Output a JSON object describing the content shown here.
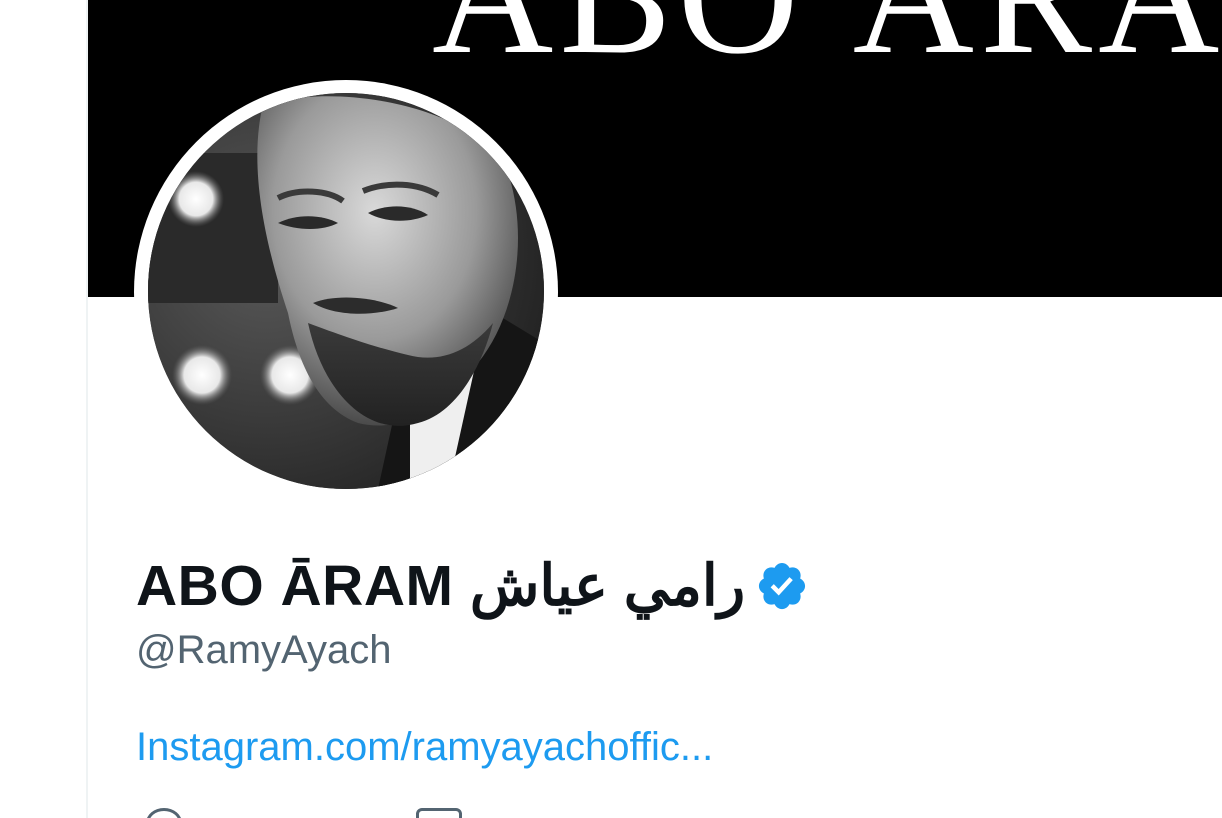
{
  "header": {
    "banner_text": "ABO ĀRA"
  },
  "profile": {
    "display_name": "ABO ĀRAM رامي عياش",
    "handle": "@RamyAyach",
    "bio_link": "Instagram.com/ramyayachoffic...",
    "verified": true
  },
  "icons": {
    "verified": "verified-check-icon",
    "location": "location-pin-icon",
    "calendar": "calendar-icon"
  },
  "colors": {
    "text_primary": "#0f1419",
    "text_secondary": "#536471",
    "link": "#1d9bf0",
    "verified": "#1d9bf0"
  }
}
